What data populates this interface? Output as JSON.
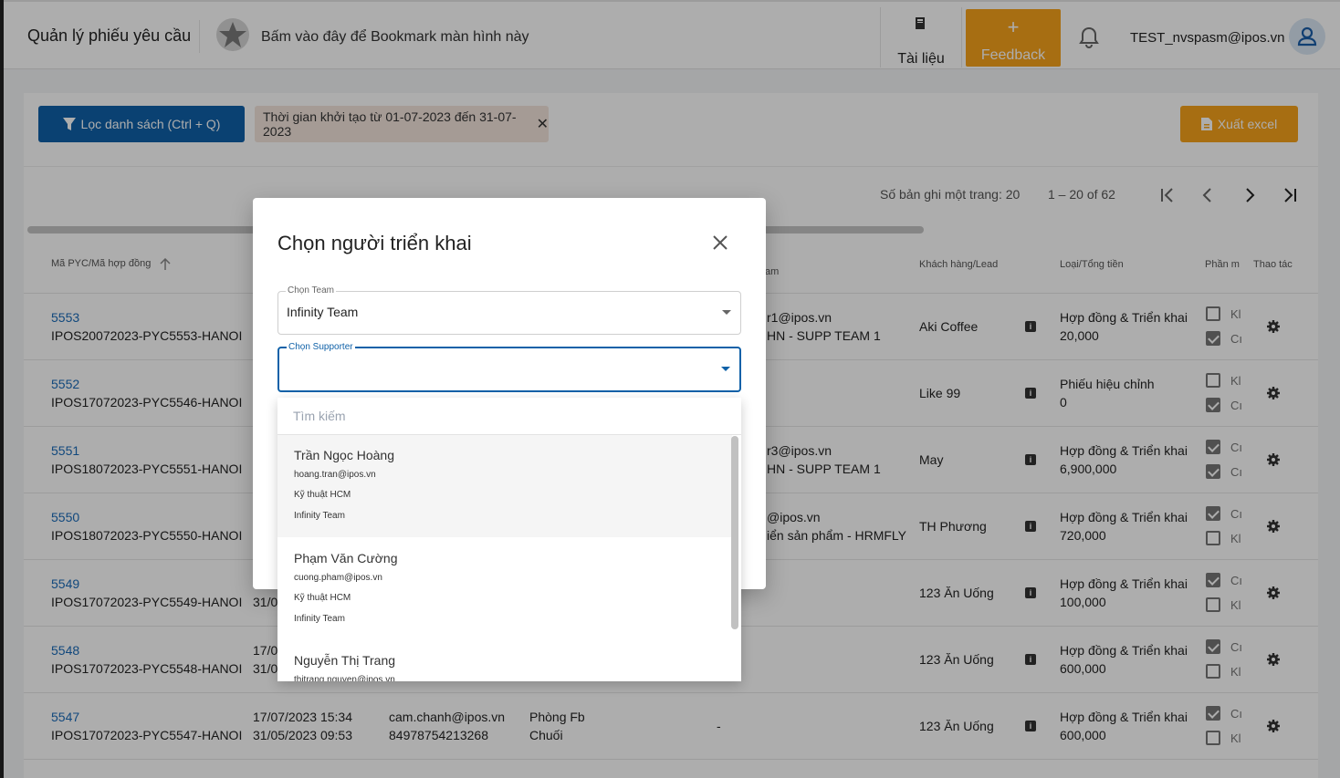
{
  "header": {
    "title": "Quản lý phiếu yêu cầu",
    "bookmark_text": "Bấm vào đây để Bookmark màn hình này",
    "docs_label": "Tài liệu",
    "feedback_plus": "+",
    "feedback_label": "Feedback",
    "user_email": "TEST_nvspasm@ipos.vn"
  },
  "toolbar": {
    "filter_label": "Lọc danh sách (Ctrl + Q)",
    "chip_text": "Thời gian khởi tạo từ 01-07-2023 đến 31-07-2023",
    "chip_close": "✕",
    "export_label": "Xuất excel"
  },
  "pagination": {
    "page_size_text": "Số bản ghi một trang: 20",
    "range_text": "1 – 20 of 62"
  },
  "table": {
    "headers": {
      "code": "Mã PYC/Mã hợp đồng",
      "team_partial": "am",
      "customer": "Khách hàng/Lead",
      "type": "Loại/Tổng tiền",
      "phan": "Phần m",
      "actions": "Thao tác"
    },
    "rows": [
      {
        "id": "5553",
        "contract": "IPOS20072023-PYC5553-HANOI",
        "d1": "",
        "d2": "",
        "c1": "r1@ipos.vn",
        "c2": "HN - SUPP TEAM 1",
        "p1": "",
        "p2": "",
        "dash": "",
        "customer": "Aki Coffee",
        "type": "Hợp đồng & Triển khai",
        "amount": "20,000",
        "cb1": false,
        "cb1l": "Kl",
        "cb2": true,
        "cb2l": "Cı"
      },
      {
        "id": "5552",
        "contract": "IPOS17072023-PYC5546-HANOI",
        "d1": "",
        "d2": "",
        "c1": "",
        "c2": "",
        "p1": "",
        "p2": "",
        "dash": "",
        "customer": "Like 99",
        "type": "Phiếu hiệu chỉnh",
        "amount": "0",
        "cb1": false,
        "cb1l": "Kl",
        "cb2": true,
        "cb2l": "Cı"
      },
      {
        "id": "5551",
        "contract": "IPOS18072023-PYC5551-HANOI",
        "d1": "",
        "d2": "",
        "c1": "r3@ipos.vn",
        "c2": "HN - SUPP TEAM 1",
        "p1": "",
        "p2": "",
        "dash": "",
        "customer": "May",
        "type": "Hợp đồng & Triển khai",
        "amount": "6,900,000",
        "cb1": true,
        "cb1l": "Cı",
        "cb2": true,
        "cb2l": "Cı"
      },
      {
        "id": "5550",
        "contract": "IPOS18072023-PYC5550-HANOI",
        "d1": "",
        "d2": "",
        "c1": "@ipos.vn",
        "c2": "iển sản phẩm - HRMFLY",
        "p1": "",
        "p2": "",
        "dash": "",
        "customer": "TH Phương",
        "type": "Hợp đồng & Triển khai",
        "amount": "720,000",
        "cb1": true,
        "cb1l": "Cı",
        "cb2": false,
        "cb2l": "Kl"
      },
      {
        "id": "5549",
        "contract": "IPOS17072023-PYC5549-HANOI",
        "d1": "",
        "d2": "31/0",
        "c1": "",
        "c2": "",
        "p1": "",
        "p2": "",
        "dash": "",
        "customer": "123 Ăn Uống",
        "type": "Hợp đồng & Triển khai",
        "amount": "100,000",
        "cb1": true,
        "cb1l": "Cı",
        "cb2": false,
        "cb2l": "Kl"
      },
      {
        "id": "5548",
        "contract": "IPOS17072023-PYC5548-HANOI",
        "d1": "17/0",
        "d2": "31/0",
        "c1": "",
        "c2": "",
        "p1": "",
        "p2": "",
        "dash": "",
        "customer": "123 Ăn Uống",
        "type": "Hợp đồng & Triển khai",
        "amount": "600,000",
        "cb1": true,
        "cb1l": "Cı",
        "cb2": false,
        "cb2l": "Kl"
      },
      {
        "id": "5547",
        "contract": "IPOS17072023-PYC5547-HANOI",
        "d1": "17/07/2023 15:34",
        "d2": "31/05/2023 09:53",
        "c1": "cam.chanh@ipos.vn",
        "c2": "84978754213268",
        "p1": "Phòng Fb",
        "p2": "Chuối",
        "dash": "-",
        "customer": "123 Ăn Uống",
        "type": "Hợp đồng & Triển khai",
        "amount": "600,000",
        "cb1": true,
        "cb1l": "Cı",
        "cb2": false,
        "cb2l": "Kl"
      }
    ]
  },
  "dialog": {
    "title": "Chọn người triển khai",
    "team_label": "Chọn Team",
    "team_value": "Infinity Team",
    "supporter_label": "Chọn Supporter",
    "supporter_value": "",
    "search_placeholder": "Tìm kiếm",
    "options": [
      {
        "name": "Trần Ngọc Hoàng",
        "email": "hoang.tran@ipos.vn",
        "dept": "Kỹ thuật HCM",
        "team": "Infinity Team"
      },
      {
        "name": "Phạm Văn Cường",
        "email": "cuong.pham@ipos.vn",
        "dept": "Kỹ thuật HCM",
        "team": "Infinity Team"
      },
      {
        "name": "Nguyễn Thị Trang",
        "email": "thitrang.nguyen@ipos.vn",
        "dept": "",
        "team": ""
      }
    ]
  },
  "colors": {
    "primary": "#0f61a8",
    "accent": "#f6a21b"
  }
}
